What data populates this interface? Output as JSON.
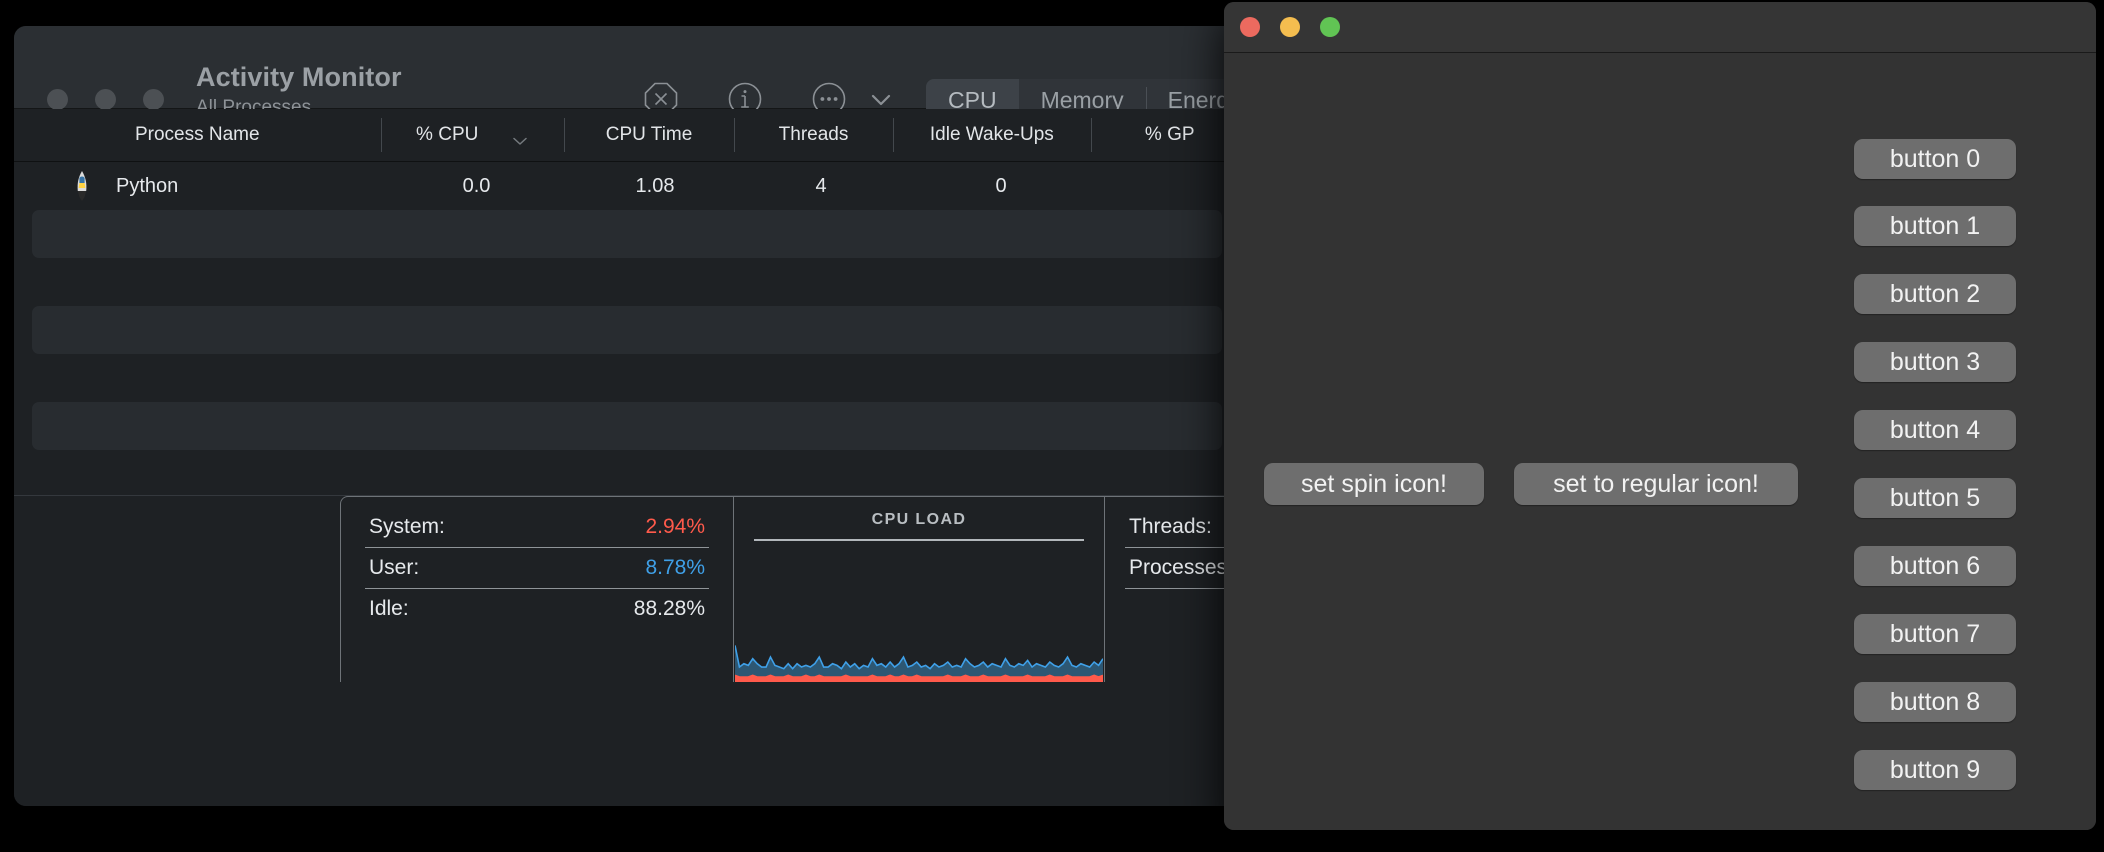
{
  "activity_monitor": {
    "window_title": "Activity Monitor",
    "window_subtitle": "All Processes",
    "traffic_lights": [
      "close",
      "minimize",
      "zoom"
    ],
    "toolbar": {
      "quit_process_icon": "octagon-x-icon",
      "inspect_icon": "info-circle-icon",
      "more_icon": "ellipsis-circle-icon",
      "chevron_icon": "chevron-down-icon"
    },
    "tabs": [
      {
        "label": "CPU",
        "selected": true
      },
      {
        "label": "Memory",
        "selected": false
      },
      {
        "label": "Energy",
        "selected": false
      }
    ],
    "columns": [
      "Process Name",
      "% CPU",
      "CPU Time",
      "Threads",
      "Idle Wake-Ups",
      "% GP"
    ],
    "sort_column": "% CPU",
    "rows": [
      {
        "icon": "python-rocket-icon",
        "process_name": "Python",
        "cpu_percent": "0.0",
        "cpu_time": "1.08",
        "threads": "4",
        "idle_wake_ups": "0"
      }
    ],
    "stats": {
      "left": [
        {
          "label": "System:",
          "value": "2.94%",
          "color_class": "red"
        },
        {
          "label": "User:",
          "value": "8.78%",
          "color_class": "blue"
        },
        {
          "label": "Idle:",
          "value": "88.28%",
          "color_class": ""
        }
      ],
      "graph_title": "CPU LOAD",
      "right": [
        {
          "label": "Threads:",
          "value": ""
        },
        {
          "label": "Processes:",
          "value": ""
        }
      ]
    },
    "colors": {
      "system_red": "#ff5a4b",
      "user_blue": "#3fa0e8",
      "window_bg": "#1e2124",
      "titlebar_bg": "#2b2f33"
    }
  },
  "tk_window": {
    "traffic_lights": {
      "close": "#ec6a5f",
      "minimize": "#f4bd4f",
      "zoom": "#61c454"
    },
    "numbered_buttons": [
      "button 0",
      "button 1",
      "button 2",
      "button 3",
      "button 4",
      "button 5",
      "button 6",
      "button 7",
      "button 8",
      "button 9"
    ],
    "action_buttons": {
      "spin": "set spin icon!",
      "regular": "set to regular icon!"
    }
  },
  "chart_data": {
    "type": "area",
    "title": "CPU LOAD",
    "xlabel": "",
    "ylabel": "",
    "ylim": [
      0,
      100
    ],
    "grid": false,
    "legend": "none",
    "series": [
      {
        "name": "User",
        "color": "#3fa0e8",
        "values": [
          22,
          9,
          11,
          10,
          14,
          11,
          9,
          9,
          15,
          10,
          9,
          8,
          11,
          8,
          11,
          9,
          10,
          9,
          11,
          15,
          9,
          9,
          11,
          10,
          8,
          12,
          9,
          11,
          8,
          10,
          9,
          14,
          10,
          11,
          9,
          12,
          9,
          11,
          15,
          9,
          10,
          12,
          9,
          10,
          8,
          11,
          9,
          10,
          12,
          9,
          10,
          9,
          14,
          11,
          9,
          10,
          12,
          9,
          11,
          10,
          9,
          14,
          10,
          9,
          11,
          10,
          13,
          9,
          11,
          10,
          9,
          12,
          10,
          9,
          11,
          15,
          10,
          9,
          11,
          10,
          9,
          12,
          10,
          14
        ]
      },
      {
        "name": "System",
        "color": "#ff5a4b",
        "values": [
          4,
          3,
          3,
          3,
          4,
          3,
          3,
          3,
          4,
          3,
          3,
          3,
          4,
          3,
          3,
          3,
          4,
          3,
          3,
          4,
          3,
          3,
          3,
          3,
          3,
          4,
          3,
          3,
          3,
          3,
          3,
          4,
          3,
          3,
          3,
          4,
          3,
          3,
          4,
          3,
          3,
          4,
          3,
          3,
          3,
          3,
          3,
          3,
          4,
          3,
          3,
          3,
          4,
          3,
          3,
          3,
          4,
          3,
          3,
          3,
          3,
          4,
          3,
          3,
          3,
          3,
          4,
          3,
          3,
          3,
          3,
          4,
          3,
          3,
          3,
          4,
          3,
          3,
          3,
          3,
          3,
          4,
          3,
          4
        ]
      }
    ]
  }
}
